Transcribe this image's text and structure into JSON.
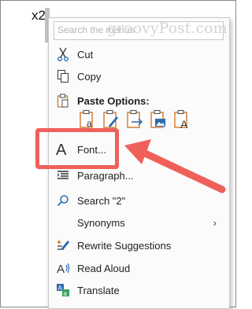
{
  "document": {
    "text": "x2"
  },
  "menu": {
    "search_placeholder": "Search the menus",
    "watermark": "groovyPost.com",
    "items": {
      "cut": "Cut",
      "copy": "Copy",
      "paste_options": "Paste Options:",
      "font": "Font...",
      "paragraph": "Paragraph...",
      "search": "Search \"2\"",
      "synonyms": "Synonyms",
      "rewrite": "Rewrite Suggestions",
      "read_aloud": "Read Aloud",
      "translate": "Translate"
    },
    "paste_icons": [
      "keep-source-formatting-icon",
      "merge-formatting-icon",
      "picture-paste-icon",
      "keep-text-only-icon",
      "text-paste-icon"
    ],
    "synonyms_chevron": "›"
  },
  "colors": {
    "highlight": "#f0605a",
    "arrow": "#f0605a",
    "icon_blue": "#2b6cb0",
    "icon_orange": "#d0782a"
  }
}
